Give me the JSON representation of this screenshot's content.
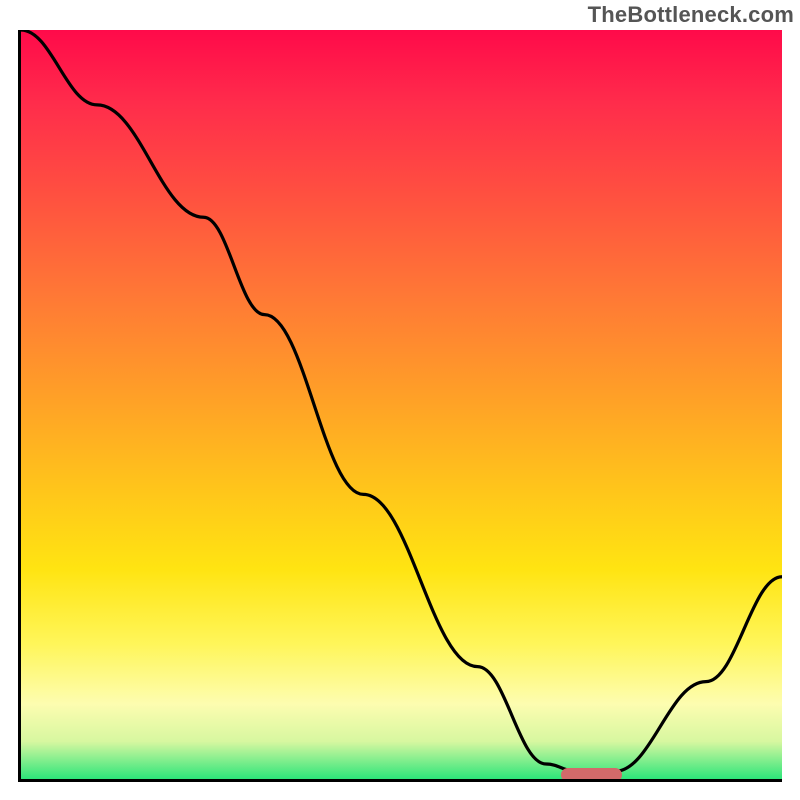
{
  "watermark": "TheBottleneck.com",
  "chart_data": {
    "type": "line",
    "title": "",
    "xlabel": "",
    "ylabel": "",
    "xlim": [
      0,
      100
    ],
    "ylim": [
      0,
      100
    ],
    "grid": false,
    "series": [
      {
        "name": "bottleneck-curve",
        "x": [
          0,
          10,
          24,
          32,
          45,
          60,
          69,
          73,
          78,
          90,
          100
        ],
        "values": [
          100,
          90,
          75,
          62,
          38,
          15,
          2,
          1,
          1,
          13,
          27
        ]
      }
    ],
    "optimum_marker": {
      "x_start": 71,
      "x_end": 79,
      "y": 0.6
    },
    "gradient_colors": {
      "top": "#ff0a4a",
      "mid": "#ffe412",
      "bottom": "#2de57a"
    }
  }
}
